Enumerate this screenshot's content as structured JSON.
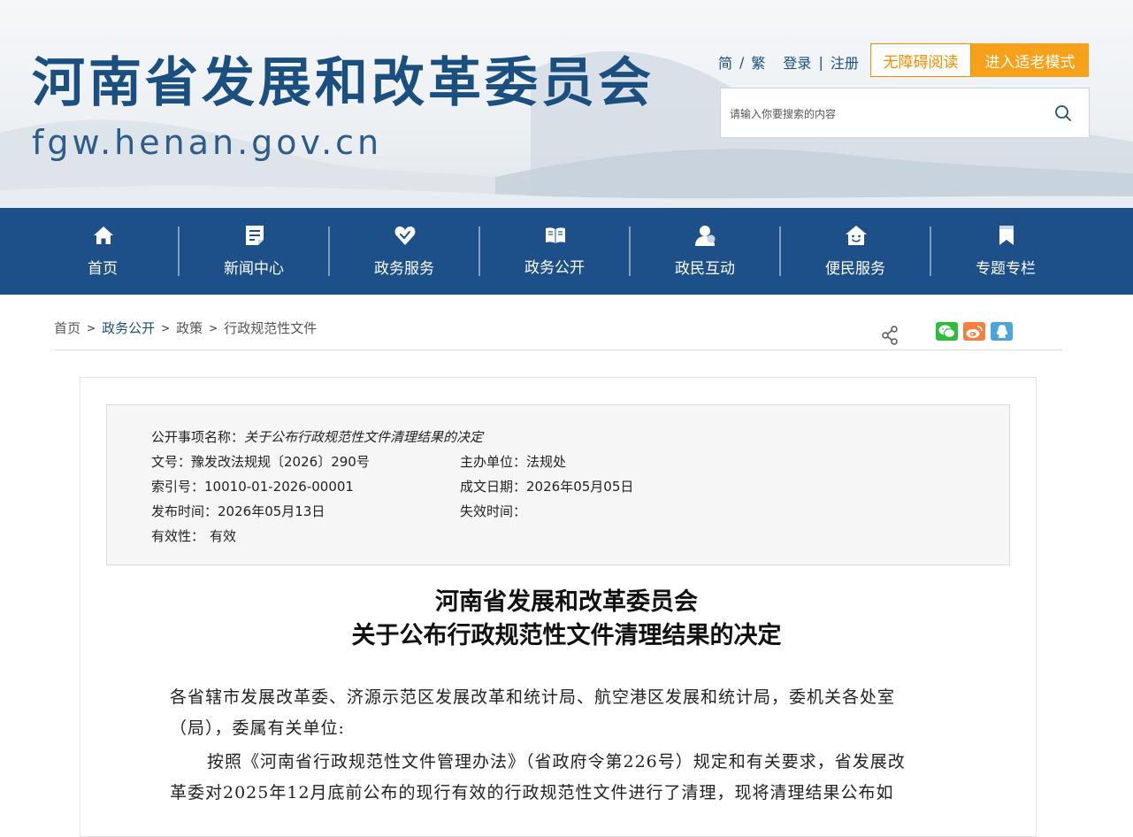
{
  "header": {
    "site_title": "河南省发展和改革委员会",
    "site_domain": "fgw.henan.gov.cn",
    "lang_simplified": "简",
    "lang_traditional": "繁",
    "login": "登录",
    "register": "注册",
    "accessibility_button": "无障碍阅读",
    "elder_mode_button": "进入适老模式",
    "search_placeholder": "请输入你要搜索的内容"
  },
  "nav": {
    "items": [
      {
        "label": "首页",
        "icon": "home-icon"
      },
      {
        "label": "新闻中心",
        "icon": "news-icon"
      },
      {
        "label": "政务服务",
        "icon": "handshake-icon"
      },
      {
        "label": "政务公开",
        "icon": "book-icon"
      },
      {
        "label": "政民互动",
        "icon": "people-icon"
      },
      {
        "label": "便民服务",
        "icon": "house-smile-icon"
      },
      {
        "label": "专题专栏",
        "icon": "bookmark-icon"
      }
    ]
  },
  "breadcrumb": [
    "首页",
    "政务公开",
    "政策",
    "行政规范性文件"
  ],
  "share": {
    "icons": [
      "share-icon",
      "wechat-icon",
      "weibo-icon",
      "qq-icon"
    ]
  },
  "meta": {
    "item_name_label": "公开事项名称：",
    "item_name": "关于公布行政规范性文件清理结果的决定",
    "doc_no_label": "文号：",
    "doc_no": "豫发改法规规〔2026〕290号",
    "issuer_label": "主办单位：",
    "issuer": "法规处",
    "index_label": "索引号：",
    "index": "10010-01-2026-00001",
    "date_label": "成文日期：",
    "date": "2026年05月05日",
    "publish_label": "发布时间：",
    "publish": "2026年05月13日",
    "expire_label": "失效时间：",
    "expire": "",
    "validity_label": "有效性：",
    "validity": "有效"
  },
  "document": {
    "title_line1": "河南省发展和改革委员会",
    "title_line2": "关于公布行政规范性文件清理结果的决定",
    "para1_line1": "各省辖市发展改革委、济源示范区发展改革和统计局、航空港区发展和统计局，委机关各处室",
    "para1_line2": "（局），委属有关单位:",
    "para2_line1": "按照《河南省行政规范性文件管理办法》（省政府令第226号）规定和有关要求，省发展改",
    "para2_line2": "革委对2025年12月底前公布的现行有效的行政规范性文件进行了清理，现将清理结果公布如"
  },
  "colors": {
    "nav_bg": "#1d5089",
    "title_blue": "#1a4f80",
    "accent_orange": "#f7a01a",
    "wechat_green": "#2dbd3b",
    "weibo_orange": "#f5803e",
    "qq_blue": "#4aa5dc"
  }
}
